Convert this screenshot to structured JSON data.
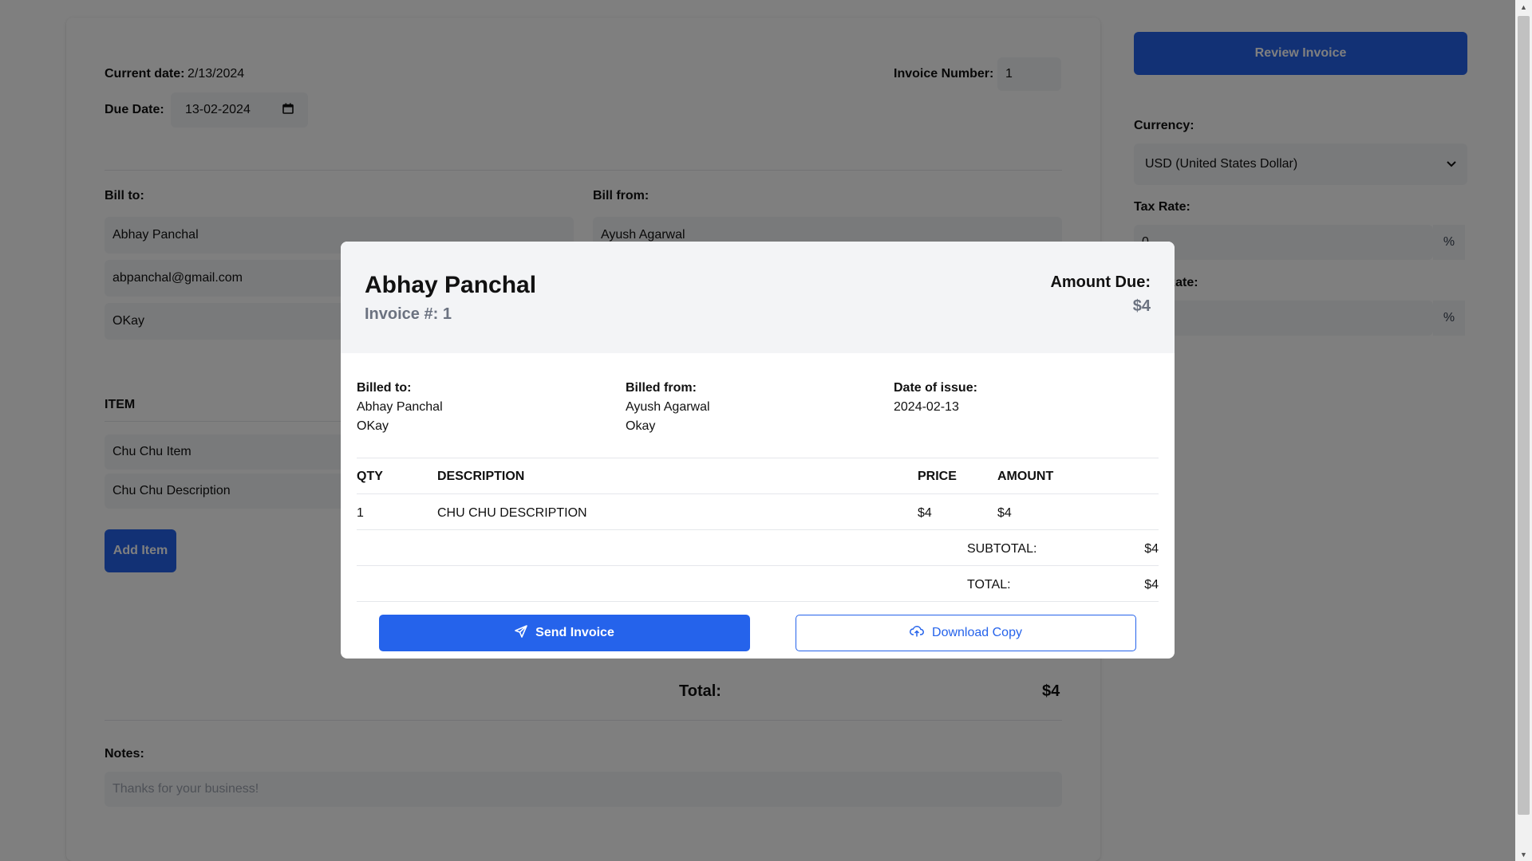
{
  "form": {
    "current_date_label": "Current date:",
    "current_date_value": "2/13/2024",
    "invoice_number_label": "Invoice Number:",
    "invoice_number_value": "1",
    "due_date_label": "Due Date:",
    "due_date_value": "13-02-2024",
    "bill_to_label": "Bill to:",
    "bill_to_name": "Abhay Panchal",
    "bill_to_email": "abpanchal@gmail.com",
    "bill_to_address": "OKay",
    "bill_from_label": "Bill from:",
    "bill_from_name": "Ayush Agarwal",
    "item_header": "ITEM",
    "item_name": "Chu Chu Item",
    "item_description": "Chu Chu Description",
    "add_item_label": "Add Item",
    "total_label": "Total:",
    "total_value": "$4",
    "notes_label": "Notes:",
    "notes_placeholder": "Thanks for your business!"
  },
  "sidebar": {
    "review_button": "Review Invoice",
    "currency_label": "Currency:",
    "currency_value": "USD (United States Dollar)",
    "tax_rate_label": "Tax Rate:",
    "tax_rate_value": "0",
    "discount_rate_label": "nt Rate:",
    "percent_symbol": "%"
  },
  "modal": {
    "customer_name": "Abhay Panchal",
    "invoice_label": "Invoice #: 1",
    "amount_due_label": "Amount Due:",
    "amount_due_value": "$4",
    "billed_to_label": "Billed to:",
    "billed_to_name": "Abhay Panchal",
    "billed_to_address": "OKay",
    "billed_from_label": "Billed from:",
    "billed_from_name": "Ayush Agarwal",
    "billed_from_address": "Okay",
    "date_of_issue_label": "Date of issue:",
    "date_of_issue_value": "2024-02-13",
    "table": {
      "headers": {
        "qty": "QTY",
        "description": "DESCRIPTION",
        "price": "PRICE",
        "amount": "AMOUNT"
      },
      "rows": [
        {
          "qty": "1",
          "description": "CHU CHU DESCRIPTION",
          "price": "$4",
          "amount": "$4"
        }
      ]
    },
    "subtotal_label": "SUBTOTAL:",
    "subtotal_value": "$4",
    "total_label": "TOTAL:",
    "total_value": "$4",
    "send_button": "Send Invoice",
    "download_button": "Download Copy"
  },
  "icons": {
    "send": "paper-plane-icon",
    "download": "cloud-upload-icon",
    "calendar": "calendar-icon",
    "chevron": "chevron-down-icon"
  },
  "colors": {
    "primary": "#2563eb",
    "overlay": "rgba(0,0,0,0.5)",
    "input_bg": "#f3f4f6"
  }
}
